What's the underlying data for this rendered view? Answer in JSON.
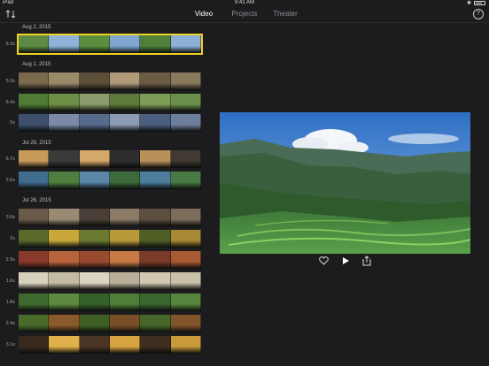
{
  "status": {
    "device": "iPad",
    "time": "9:41 AM"
  },
  "tabs": [
    {
      "label": "Video",
      "active": true
    },
    {
      "label": "Projects",
      "active": false
    },
    {
      "label": "Theater",
      "active": false
    }
  ],
  "help_label": "?",
  "dates": [
    "Aug 2, 2015",
    "Aug 1, 2015",
    "Jul 29, 2015",
    "Jul 26, 2015"
  ],
  "clips": [
    {
      "duration": "8.3s",
      "selected": true,
      "colors": [
        "#5d8a44",
        "#8fb3d8",
        "#5b8f3f",
        "#7fa7cf",
        "#4f7f38",
        "#8cb0d6"
      ]
    },
    {
      "duration": "5.9s",
      "selected": false,
      "colors": [
        "#7a6a4c",
        "#9a8a6a",
        "#5c4f3a",
        "#b09a7a",
        "#6d5c44",
        "#8a7a5c"
      ]
    },
    {
      "duration": "8.4s",
      "selected": false,
      "colors": [
        "#4f7b34",
        "#6c8f45",
        "#8a9a6a",
        "#5f7a3c",
        "#7d9c56",
        "#6a8f4a"
      ]
    },
    {
      "duration": "5s",
      "selected": false,
      "colors": [
        "#3d4f6a",
        "#7a8aa8",
        "#566b8c",
        "#8c9ab4",
        "#4a5f7f",
        "#6d7f9c"
      ]
    },
    {
      "duration": "6.7s",
      "selected": false,
      "colors": [
        "#c79a5a",
        "#3a3a3a",
        "#d4a868",
        "#2e2e2e",
        "#b8905a",
        "#403a32"
      ]
    },
    {
      "duration": "2.6s",
      "selected": false,
      "colors": [
        "#3f6d8f",
        "#4f7f3f",
        "#5a86a8",
        "#3d6a3a",
        "#4c7d9a",
        "#4a7a44"
      ]
    },
    {
      "duration": "3.8s",
      "selected": false,
      "colors": [
        "#6a5a4a",
        "#9a8a74",
        "#4a3f36",
        "#8a7a66",
        "#5c4e40",
        "#7c6c5a"
      ]
    },
    {
      "duration": "2s",
      "selected": false,
      "colors": [
        "#5a6a2a",
        "#c8a83a",
        "#6a7a32",
        "#b89a3a",
        "#4f5f26",
        "#a88a34"
      ]
    },
    {
      "duration": "2.9s",
      "selected": false,
      "colors": [
        "#8a3a2a",
        "#b8643a",
        "#9a4a2e",
        "#c87a44",
        "#7a3a28",
        "#a85a34"
      ]
    },
    {
      "duration": "1.6s",
      "selected": false,
      "colors": [
        "#d8d2bc",
        "#c4bda4",
        "#dcd6c0",
        "#b8b098",
        "#d0c8b0",
        "#c8c0a8"
      ]
    },
    {
      "duration": "1.8s",
      "selected": false,
      "colors": [
        "#3f6a2e",
        "#5c8a3f",
        "#34602a",
        "#4f7f36",
        "#3a6630",
        "#56843c"
      ]
    },
    {
      "duration": "2.4s",
      "selected": false,
      "colors": [
        "#4a6a2a",
        "#8a5a2a",
        "#3f5f26",
        "#7a4f28",
        "#46662a",
        "#805428"
      ]
    },
    {
      "duration": "3.1s",
      "selected": false,
      "colors": [
        "#3a2a1e",
        "#e0b04a",
        "#4a3424",
        "#d8a43f",
        "#3f2e20",
        "#c89a3a"
      ]
    },
    {
      "duration": "",
      "selected": false,
      "colors": [
        "#2e5a26",
        "#c86a9a",
        "#346a2c",
        "#d478a8",
        "#2c5424",
        "#c0689a"
      ]
    }
  ],
  "controls": {
    "favorite": "heart-icon",
    "play": "play-icon",
    "share": "share-icon"
  },
  "preview_scene": "mountain terraces under blue sky with clouds",
  "colors": {
    "background": "#1c1c1e",
    "selection": "#f2d129",
    "inactive_tab": "#8e8e93"
  }
}
